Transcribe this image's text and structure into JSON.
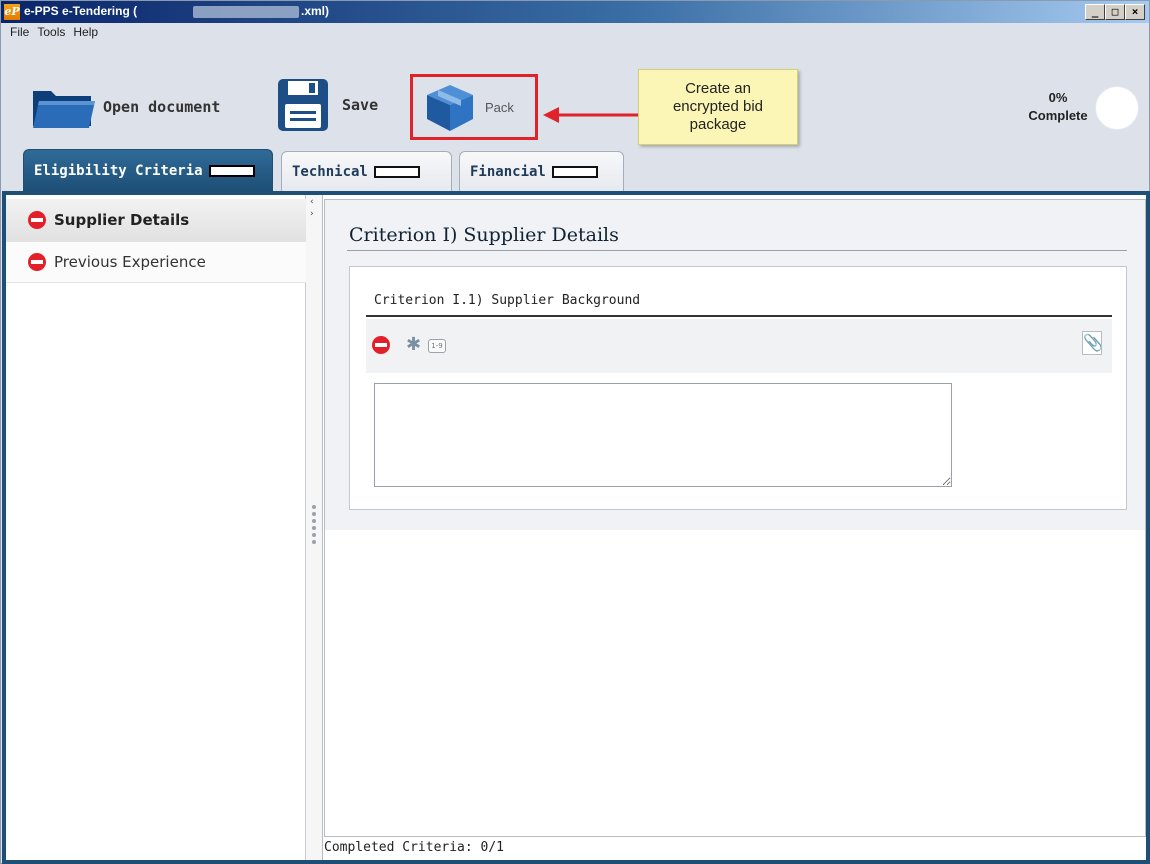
{
  "window": {
    "title_prefix": "e-PPS e-Tendering (",
    "title_suffix": ".xml)",
    "logo_text": "eP",
    "controls": {
      "minimize": "_",
      "maximize": "□",
      "close": "×"
    }
  },
  "menu": [
    "File",
    "Tools",
    "Help"
  ],
  "toolbar": {
    "open_label": "Open document",
    "save_label": "Save",
    "pack_label": "Pack",
    "callout_text": "Create an encrypted bid package",
    "progress_percent": "0%",
    "progress_label": "Complete"
  },
  "tabs": [
    {
      "label": "Eligibility Criteria",
      "active": true
    },
    {
      "label": "Technical",
      "active": false
    },
    {
      "label": "Financial",
      "active": false
    }
  ],
  "sidebar": {
    "items": [
      {
        "label": "Supplier Details",
        "selected": true
      },
      {
        "label": "Previous Experience",
        "selected": false
      }
    ]
  },
  "main": {
    "criterion_title": "Criterion I) Supplier Details",
    "sub_criterion_title": "Criterion I.1) Supplier Background",
    "num_icon_text": "1-9",
    "text_value": ""
  },
  "status": {
    "completed_text": "Completed Criteria: 0/1"
  },
  "colors": {
    "accent": "#1e4f77",
    "highlight": "#e0222a",
    "callout_bg": "#fbf6b6",
    "status_red": "#e3202a"
  }
}
